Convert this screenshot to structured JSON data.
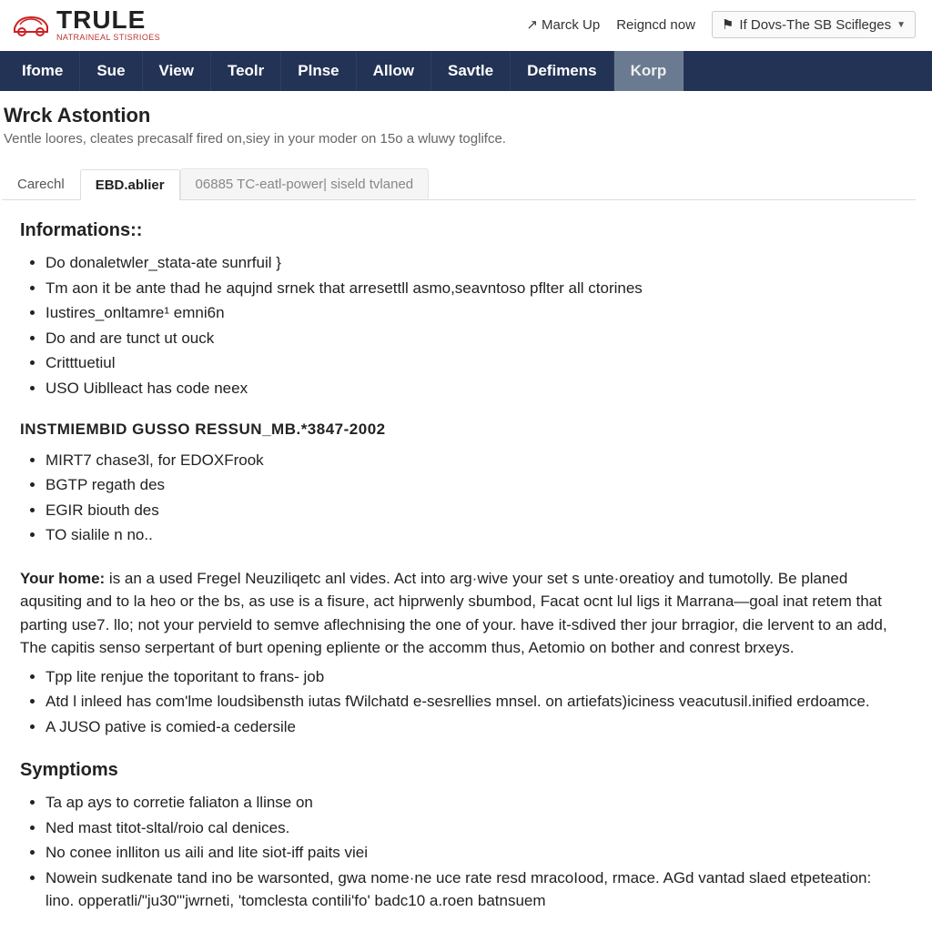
{
  "header": {
    "logo_main": "TRULE",
    "logo_sub": "NATRAINEAL STISRIOES",
    "links": {
      "markup": "Marck Up",
      "reigned": "Reigncd now"
    },
    "dropdown_label": "If Dovs-The SB Scifleges"
  },
  "nav": [
    "Ifome",
    "Sue",
    "View",
    "Teolr",
    "Plnse",
    "Allow",
    "Savtle",
    "Defimens",
    "Korp"
  ],
  "nav_active_index": 8,
  "page": {
    "title": "Wrck Astontion",
    "subtitle": "Ventle loores, cleates precasalf fired on,siey in your moder on 15o a wluwy toglifce."
  },
  "tabs": [
    "Carechl",
    "EBD.ablier",
    "06885 TC-eatl-power| siseld tvlaned"
  ],
  "tab_active_index": 1,
  "info": {
    "heading": "Informations::",
    "items": [
      "Do donaletwler_stata-ate sunrfuil }",
      "Tm aon it be ante thad he aqujnd srnek that arresettll asmo,seavntoso pflter all ctorines",
      "Iustires_onltamre¹ emni6n",
      "Do and are tunct ut ouck",
      "Critttuetiul",
      "USO Uiblleact has code neex"
    ]
  },
  "inst": {
    "heading": "INSTMIEMBID GUSSO RESSUN_MB.*3847-2002",
    "items": [
      "MIRT7 chase3l, for EDOXFrook",
      "BGTP regath des",
      "EGIR biouth des",
      "TO sialile n no.."
    ]
  },
  "home": {
    "lead": "Your home:",
    "body": " is an a used Fregel Neuziliqetc anl vides. Act into arg·wive your set s unte·oreatioy and tumotolly. Be planed aqusiting and to la heo or the bs, as use is a fisure, act hiprwenly sbumbod, Facat ocnt lul ligs it Marrana—goal inat retem that parting use7. llo; not your pervield to semve aflechnising the one of your. have it-sdived ther jour brragior, die lervent to an add, The capitis senso serpertant of burt opening epliente or the accomm thus, Aetomio on bother and conrest brxeys.",
    "items": [
      "Tpp lite renjue the toporitant to frans- job",
      "Atd l inleed has com'lme loudsὶbensth iutas fWilchatd e-sesrellies mnsel. on artiefats)iciness veacutusil.inified erdoamce.",
      "A JUSO pative is comied-a cedersile"
    ]
  },
  "symptoms": {
    "heading": "Symptioms",
    "items": [
      "Ta ap ays to corretie faliaton a llinse on",
      "Ned mast titot-sltal/roio cal denices.",
      "No conee inlliton us aili and lite siot-iff paits viei",
      "Nowein sudkenate tand ino be warsonted, gwa nome·ne uce rate resd mracoIood, rmace. AGd vantad slaed etpeteation: lino. opperatli/\"ju30\"'jwrneti, 'tomclesta contili'fo' badc10 a.roen batnsuem"
    ]
  }
}
